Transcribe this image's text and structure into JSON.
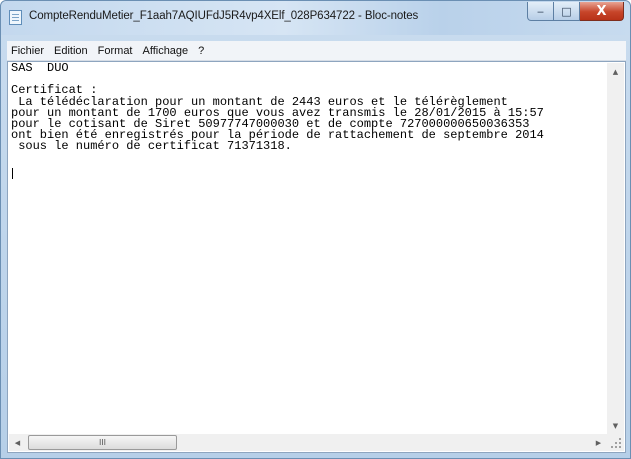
{
  "window": {
    "title": "CompteRenduMetier_F1aah7AQIUFdJ5R4vp4XElf_028P634722 - Bloc-notes",
    "controls": {
      "minimize": "‒",
      "maximize": "□",
      "close": "X"
    }
  },
  "menu": [
    "Fichier",
    "Edition",
    "Format",
    "Affichage",
    "?"
  ],
  "document": {
    "text": "SAS  DUO\n\nCertificat :\n La télédéclaration pour un montant de 2443 euros et le télérèglement\npour un montant de 1700 euros que vous avez transmis le 28/01/2015 à 15:57\npour le cotisant de Siret 50977747000030 et de compte 727000000650036353\nont bien été enregistrés pour la période de rattachement de septembre 2014\n sous le numéro de certificat 71371318."
  },
  "scrollbars": {
    "up_arrow": "▲",
    "down_arrow": "▼",
    "left_arrow": "◀",
    "right_arrow": "▶",
    "thumb_grip": "III"
  }
}
